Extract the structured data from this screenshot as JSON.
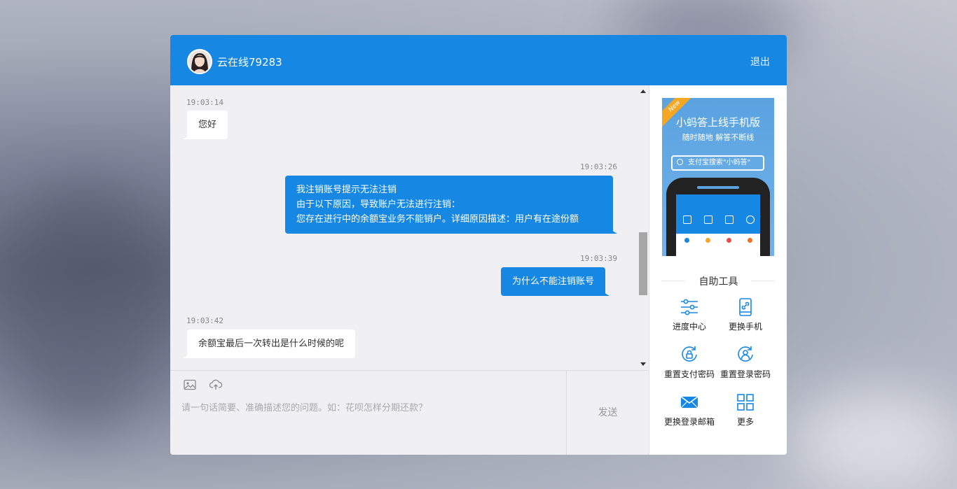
{
  "header": {
    "agent_name": "云在线79283",
    "logout_label": "退出"
  },
  "messages": [
    {
      "side": "left",
      "time": "19:03:14",
      "lines": [
        "您好"
      ]
    },
    {
      "side": "right",
      "time": "19:03:26",
      "lines": [
        "我注销账号提示无法注销",
        "由于以下原因，导致账户无法进行注销：",
        "您存在进行中的余额宝业务不能销户。详细原因描述：用户有在途份额"
      ]
    },
    {
      "side": "right",
      "time": "19:03:39",
      "lines": [
        "为什么不能注销账号"
      ]
    },
    {
      "side": "left",
      "time": "19:03:42",
      "lines": [
        "余额宝最后一次转出是什么时候的呢"
      ]
    }
  ],
  "input": {
    "placeholder": "请一句话简要、准确描述您的问题。如：花呗怎样分期还款？",
    "send_label": "发送"
  },
  "sidebar": {
    "banner": {
      "ribbon": "New",
      "title": "小蚂答上线手机版",
      "subtitle": "随时随地 解答不断线",
      "search_text": "支付宝搜索\"小蚂答\""
    },
    "tools_title": "自助工具",
    "tools": [
      {
        "label": "进度中心",
        "icon": "sliders-icon"
      },
      {
        "label": "更换手机",
        "icon": "phone-link-icon"
      },
      {
        "label": "重置支付密码",
        "icon": "lock-reset-icon"
      },
      {
        "label": "重置登录密码",
        "icon": "user-reset-icon"
      },
      {
        "label": "更换登录邮箱",
        "icon": "mail-icon"
      },
      {
        "label": "更多",
        "icon": "grid-icon"
      }
    ]
  },
  "colors": {
    "primary": "#1688e4",
    "chat_bg": "#f0eff2",
    "bubble_left": "#ffffff"
  }
}
